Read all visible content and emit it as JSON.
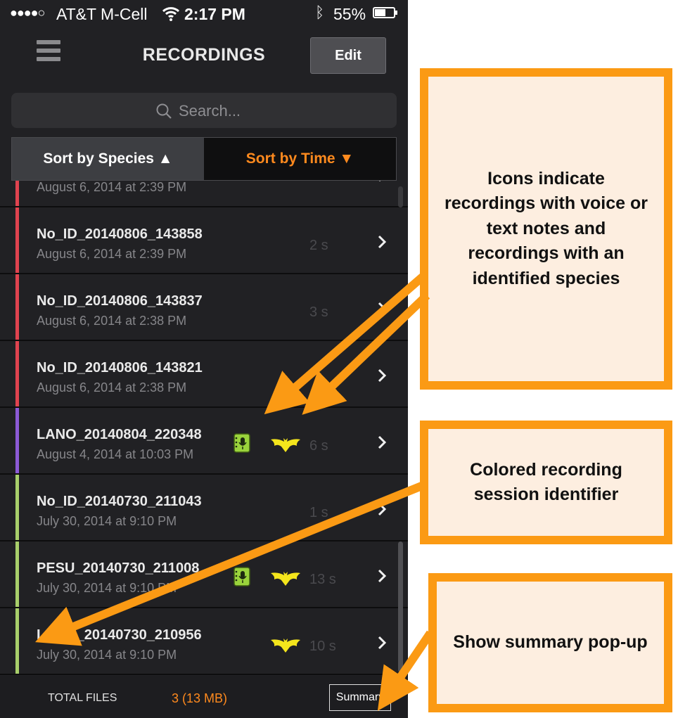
{
  "status_bar": {
    "signal": "●●●●○",
    "carrier": "AT&T M-Cell",
    "time": "2:17 PM",
    "battery_percent": "55%",
    "battery_level": 0.55
  },
  "nav": {
    "title": "RECORDINGS",
    "edit_label": "Edit"
  },
  "search": {
    "placeholder": "Search..."
  },
  "sort": {
    "species_label": "Sort by Species ▲",
    "time_label": "Sort by Time ▼"
  },
  "recordings": [
    {
      "name": "",
      "date": "August 6, 2014 at 2:39 PM",
      "duration": "",
      "session_color": "#e0434f",
      "has_note": false,
      "has_species": false
    },
    {
      "name": "No_ID_20140806_143858",
      "date": "August 6, 2014 at 2:39 PM",
      "duration": "2 s",
      "session_color": "#e0434f",
      "has_note": false,
      "has_species": false
    },
    {
      "name": "No_ID_20140806_143837",
      "date": "August 6, 2014 at 2:38 PM",
      "duration": "3 s",
      "session_color": "#e0434f",
      "has_note": false,
      "has_species": false
    },
    {
      "name": "No_ID_20140806_143821",
      "date": "August 6, 2014 at 2:38 PM",
      "duration": "",
      "session_color": "#e0434f",
      "has_note": false,
      "has_species": false
    },
    {
      "name": "LANO_20140804_220348",
      "date": "August 4, 2014 at 10:03 PM",
      "duration": "6 s",
      "session_color": "#8c5ad6",
      "has_note": true,
      "has_species": true
    },
    {
      "name": "No_ID_20140730_211043",
      "date": "July 30, 2014 at 9:10 PM",
      "duration": "1 s",
      "session_color": "#a8cf6a",
      "has_note": false,
      "has_species": false
    },
    {
      "name": "PESU_20140730_211008",
      "date": "July 30, 2014 at 9:10 PM",
      "duration": "13 s",
      "session_color": "#a8cf6a",
      "has_note": true,
      "has_species": true
    },
    {
      "name": "LANO_20140730_210956",
      "date": "July 30, 2014 at 9:10 PM",
      "duration": "10 s",
      "session_color": "#a8cf6a",
      "has_note": false,
      "has_species": true
    }
  ],
  "footer": {
    "total_label": "TOTAL FILES",
    "total_value": "3 (13 MB)",
    "summary_label": "Summary"
  },
  "annotations": {
    "icons_text": "Icons indicate recordings with voice or text notes and recordings with an identified species",
    "session_text": "Colored recording session identifier",
    "summary_text": "Show summary pop-up"
  },
  "colors": {
    "accent_orange": "#ff8a1e",
    "callout_border": "#fb9a14",
    "callout_fill": "#fdeee0",
    "species_bat": "#f4e51c",
    "note_green": "#9ad33c"
  }
}
